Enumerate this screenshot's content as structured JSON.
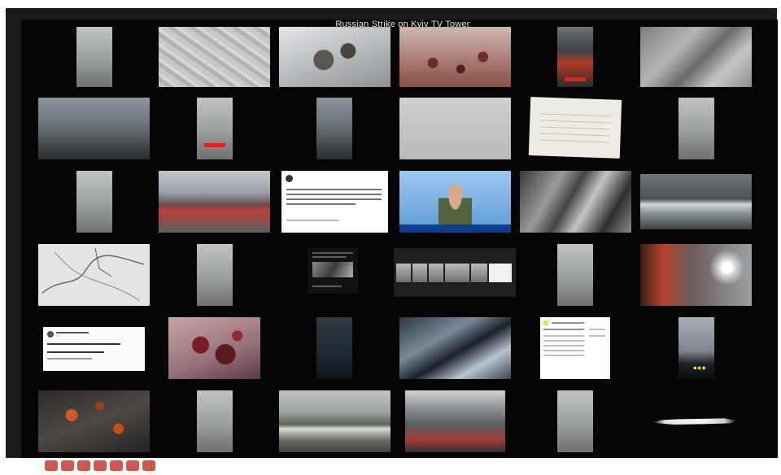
{
  "collage": {
    "title": "Russian Strike on Kyiv TV Tower"
  },
  "tiles": [
    {
      "name": "footage-tile-vertical-street",
      "icon": "video-thumbnail"
    },
    {
      "name": "footage-tile-snow-ground",
      "icon": "video-thumbnail"
    },
    {
      "name": "footage-tile-snow-debris",
      "icon": "video-thumbnail"
    },
    {
      "name": "footage-tile-crowd",
      "icon": "video-thumbnail"
    },
    {
      "name": "footage-tile-phone-red",
      "icon": "video-thumbnail"
    },
    {
      "name": "footage-tile-aerial-gray",
      "icon": "video-thumbnail"
    },
    {
      "name": "footage-tile-street-caption",
      "icon": "video-thumbnail"
    },
    {
      "name": "footage-tile-phone-bar",
      "icon": "video-thumbnail"
    },
    {
      "name": "footage-tile-vertical-road",
      "icon": "video-thumbnail"
    },
    {
      "name": "footage-tile-gray-wall",
      "icon": "video-thumbnail"
    },
    {
      "name": "document-tile-paper",
      "icon": "document-thumbnail"
    },
    {
      "name": "footage-tile-vertical-mist",
      "icon": "video-thumbnail"
    },
    {
      "name": "footage-tile-snow-street",
      "icon": "video-thumbnail"
    },
    {
      "name": "footage-tile-houses",
      "icon": "video-thumbnail"
    },
    {
      "name": "tweet-tile-1",
      "icon": "tweet-thumbnail"
    },
    {
      "name": "news-tile-briefing",
      "icon": "video-thumbnail"
    },
    {
      "name": "satellite-tile-1",
      "icon": "satellite-thumbnail"
    },
    {
      "name": "footage-tile-road",
      "icon": "video-thumbnail"
    },
    {
      "name": "sketch-tile-map",
      "icon": "map-thumbnail"
    },
    {
      "name": "footage-tile-vertical-tower",
      "icon": "video-thumbnail"
    },
    {
      "name": "document-tile-dark",
      "icon": "document-thumbnail"
    },
    {
      "name": "strip-tile-frames",
      "icon": "video-thumbnail"
    },
    {
      "name": "footage-tile-vertical-smoke",
      "icon": "video-thumbnail"
    },
    {
      "name": "footage-tile-orange-smoke",
      "icon": "video-thumbnail"
    },
    {
      "name": "tweet-tile-2",
      "icon": "tweet-thumbnail"
    },
    {
      "name": "photo-tile-red",
      "icon": "photo-thumbnail"
    },
    {
      "name": "footage-tile-dark-vertical",
      "icon": "video-thumbnail"
    },
    {
      "name": "aerial-tile-blue",
      "icon": "photo-thumbnail"
    },
    {
      "name": "article-tile-1",
      "icon": "document-thumbnail"
    },
    {
      "name": "dashcam-tile",
      "icon": "video-thumbnail"
    },
    {
      "name": "photo-tile-flowers",
      "icon": "photo-thumbnail"
    },
    {
      "name": "footage-tile-vertical-trees",
      "icon": "video-thumbnail"
    },
    {
      "name": "footage-tile-riverbank",
      "icon": "video-thumbnail"
    },
    {
      "name": "photo-tile-shop",
      "icon": "photo-thumbnail"
    },
    {
      "name": "footage-tile-vertical-park",
      "icon": "video-thumbnail"
    },
    {
      "name": "footage-tile-white-debris",
      "icon": "video-thumbnail"
    }
  ]
}
